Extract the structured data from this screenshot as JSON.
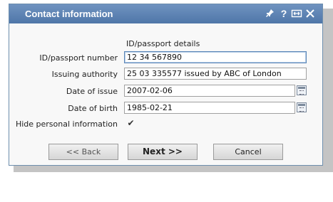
{
  "window": {
    "title": "Contact information",
    "help_label": "?"
  },
  "form": {
    "section_label": "ID/passport details",
    "fields": [
      {
        "label": "ID/passport number",
        "value": "12 34 567890"
      },
      {
        "label": "Issuing authority",
        "value": "25 03 335577 issued by ABC of London"
      },
      {
        "label": "Date of issue",
        "value": "2007-02-06"
      },
      {
        "label": "Date of birth",
        "value": "1985-02-21"
      }
    ],
    "hide_label": "Hide personal information",
    "hide_checked": true,
    "check_glyph": "✔"
  },
  "buttons": {
    "back": "<< Back",
    "next": "Next >>",
    "cancel": "Cancel"
  },
  "icons": [
    "pin-icon",
    "help-icon",
    "resize-icon",
    "close-icon",
    "calendar-icon",
    "checkmark-icon"
  ]
}
